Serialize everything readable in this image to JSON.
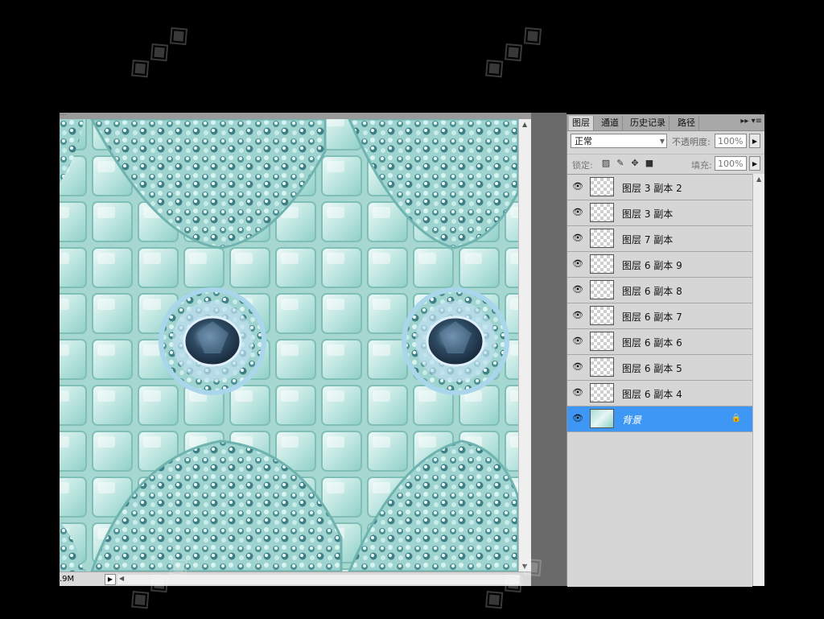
{
  "document": {
    "tab_title": "...",
    "doc_size": ".9M"
  },
  "panel": {
    "tabs": [
      {
        "label": "图层"
      },
      {
        "label": "通道"
      },
      {
        "label": "历史记录"
      },
      {
        "label": "路径"
      }
    ],
    "blend_mode": "正常",
    "opacity_label": "不透明度:",
    "opacity_value": "100%",
    "lock_label": "锁定:",
    "fill_label": "填充:",
    "fill_value": "100%",
    "layers": [
      {
        "name": "图层 3 副本 2",
        "visible": true
      },
      {
        "name": "图层 3 副本",
        "visible": true
      },
      {
        "name": "图层 7 副本",
        "visible": true
      },
      {
        "name": "图层 6 副本 9",
        "visible": true
      },
      {
        "name": "图层 6 副本 8",
        "visible": true
      },
      {
        "name": "图层 6 副本 7",
        "visible": true
      },
      {
        "name": "图层 6 副本 6",
        "visible": true
      },
      {
        "name": "图层 6 副本 5",
        "visible": true
      },
      {
        "name": "图层 6 副本 4",
        "visible": true
      },
      {
        "name": "背景",
        "visible": true,
        "selected": true,
        "locked": true
      }
    ]
  },
  "colors": {
    "selected_layer": "#3e97f4",
    "canvas_base": "#bfe3df",
    "gem_dark": "#2e4a63"
  }
}
